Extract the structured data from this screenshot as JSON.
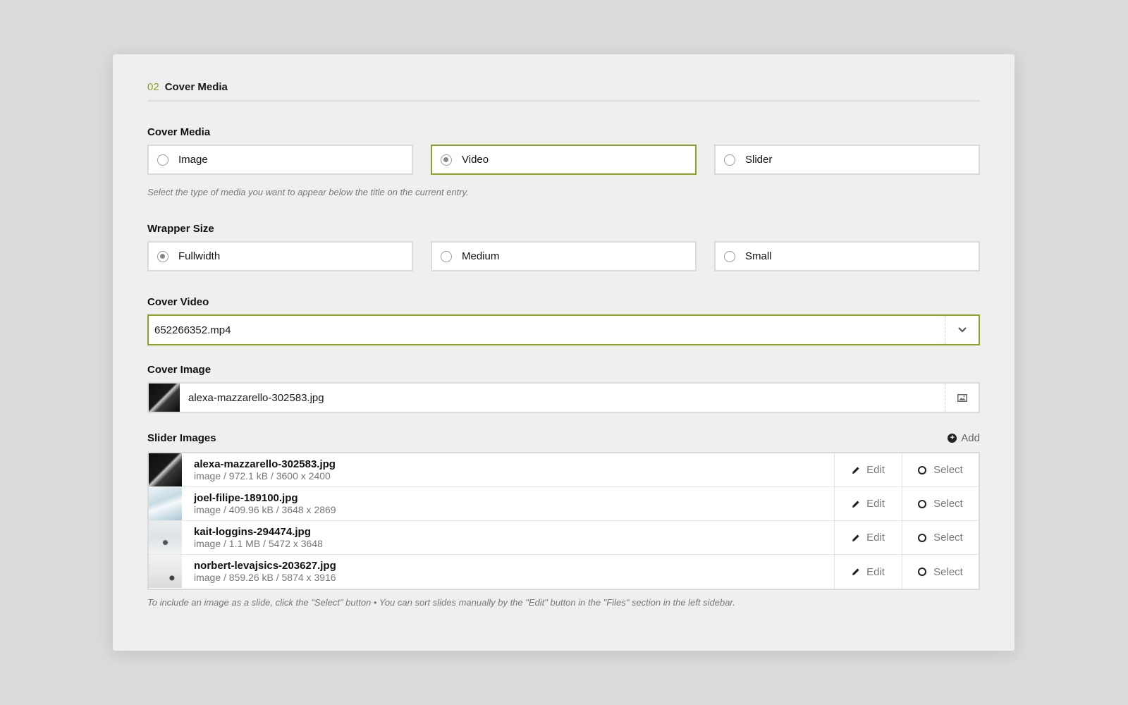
{
  "section": {
    "number": "02",
    "title": "Cover Media"
  },
  "cover_media": {
    "label": "Cover Media",
    "options": [
      "Image",
      "Video",
      "Slider"
    ],
    "selected": "Video",
    "help": "Select the type of media you want to appear below the title on the current entry."
  },
  "wrapper_size": {
    "label": "Wrapper Size",
    "options": [
      "Fullwidth",
      "Medium",
      "Small"
    ],
    "selected": "Fullwidth"
  },
  "cover_video": {
    "label": "Cover Video",
    "value": "652266352.mp4"
  },
  "cover_image": {
    "label": "Cover Image",
    "value": "alexa-mazzarello-302583.jpg"
  },
  "slider_images": {
    "label": "Slider Images",
    "add_label": "Add",
    "edit_label": "Edit",
    "select_label": "Select",
    "files": [
      {
        "name": "alexa-mazzarello-302583.jpg",
        "meta": "image / 972.1 kB / 3600 x 2400"
      },
      {
        "name": "joel-filipe-189100.jpg",
        "meta": "image / 409.96 kB / 3648 x 2869"
      },
      {
        "name": "kait-loggins-294474.jpg",
        "meta": "image / 1.1 MB / 5472 x 3648"
      },
      {
        "name": "norbert-levajsics-203627.jpg",
        "meta": "image / 859.26 kB / 5874 x 3916"
      }
    ],
    "help": "To include an image as a slide, click the \"Select\" button • You can sort slides manually by the \"Edit\" button in the \"Files\" section in the left sidebar."
  },
  "colors": {
    "accent": "#8ca32a",
    "background": "#dcdcdc",
    "panel": "#efefef"
  }
}
